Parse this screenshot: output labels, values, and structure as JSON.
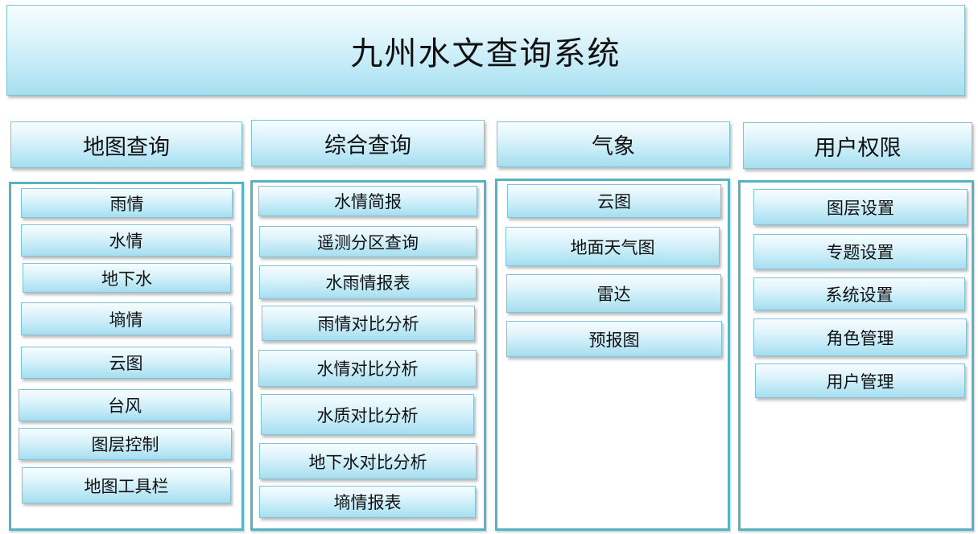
{
  "title": "九州水文查询系统",
  "columns": [
    {
      "header": "地图查询",
      "items": [
        "雨情",
        "水情",
        "地下水",
        "墒情",
        "云图",
        "台风",
        "图层控制",
        "地图工具栏"
      ]
    },
    {
      "header": "综合查询",
      "items": [
        "水情简报",
        "遥测分区查询",
        "水雨情报表",
        "雨情对比分析",
        "水情对比分析",
        "水质对比分析",
        "地下水对比分析",
        "墒情报表"
      ]
    },
    {
      "header": "气象",
      "items": [
        "云图",
        "地面天气图",
        "雷达",
        "预报图"
      ]
    },
    {
      "header": "用户权限",
      "items": [
        "图层设置",
        "专题设置",
        "系统设置",
        "角色管理",
        "用户管理"
      ]
    }
  ]
}
